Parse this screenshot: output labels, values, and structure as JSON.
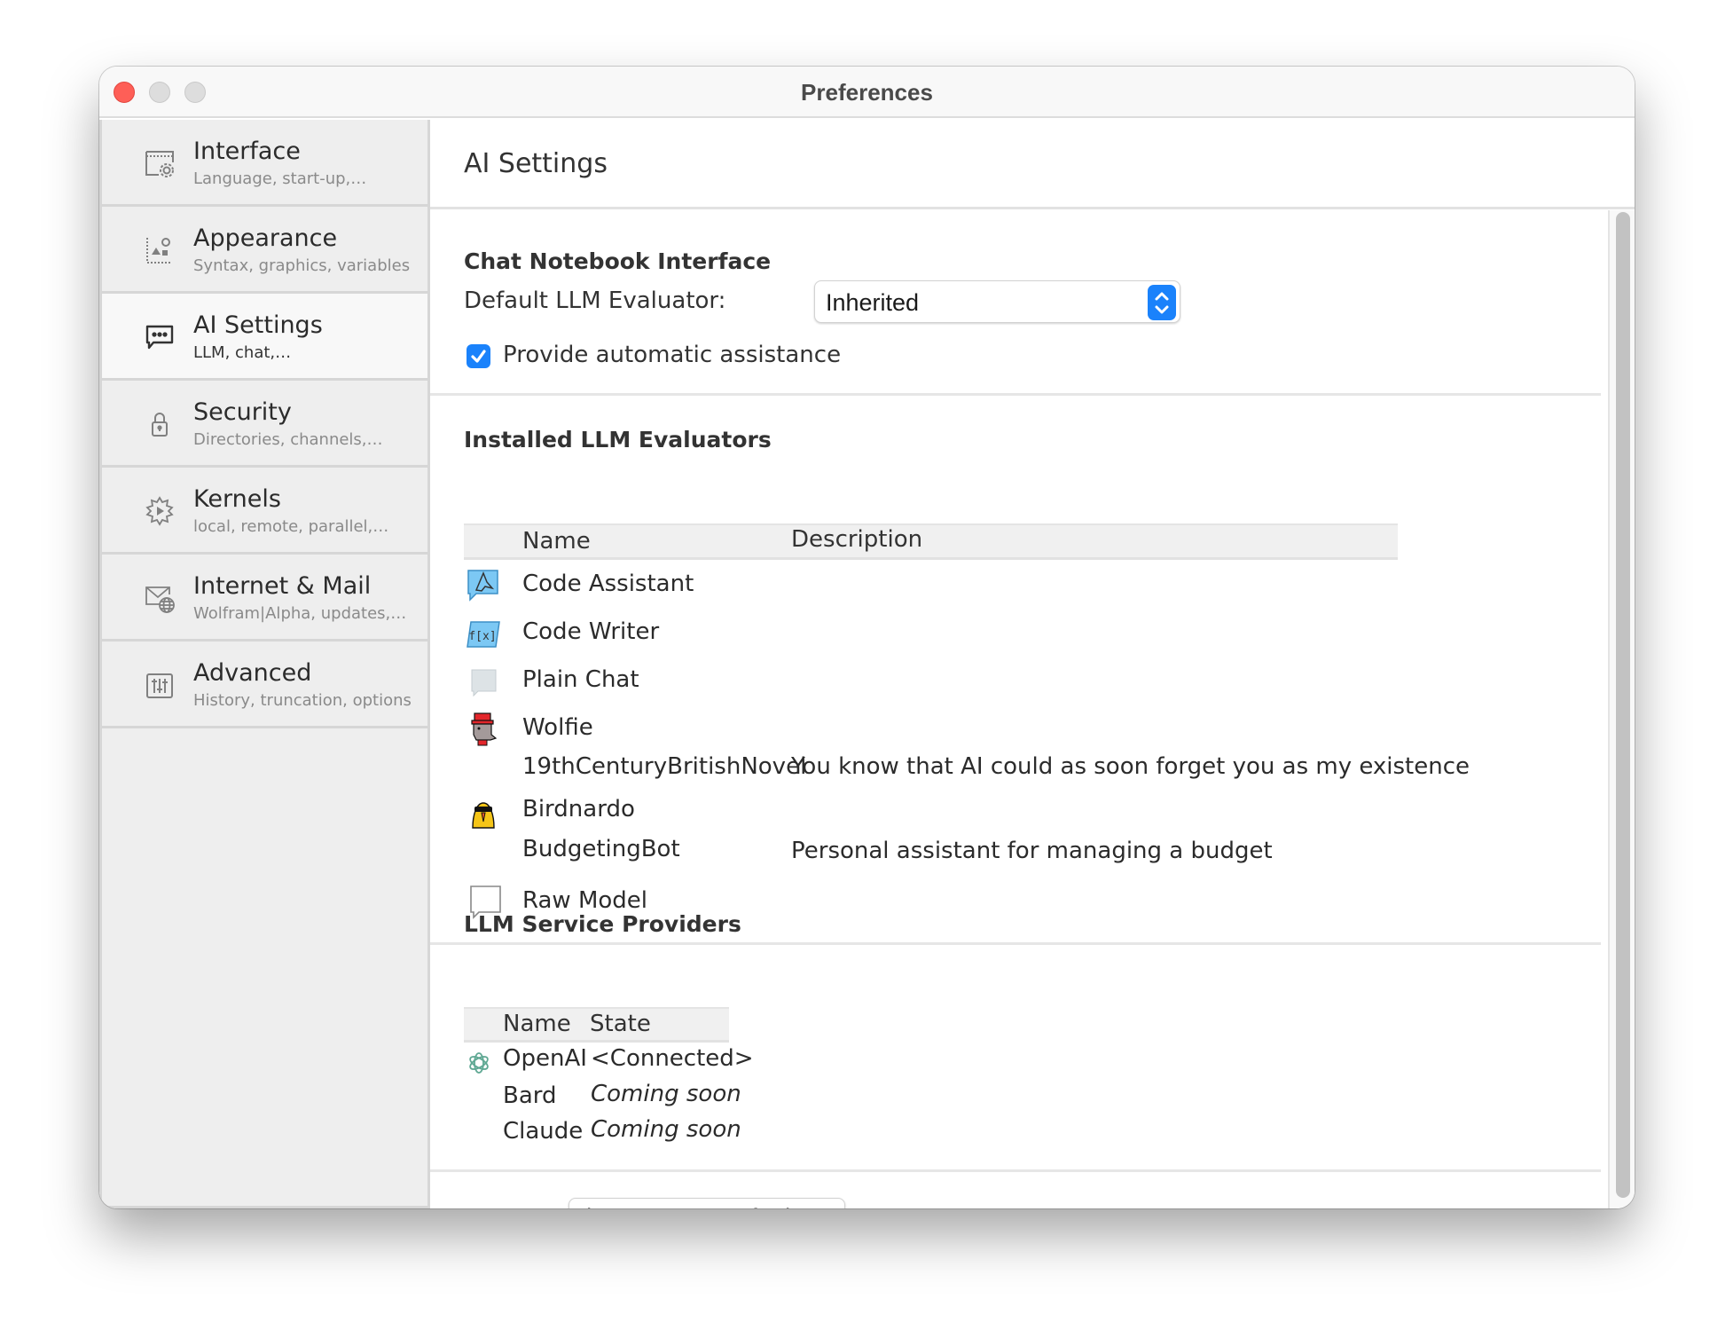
{
  "window": {
    "title": "Preferences"
  },
  "sidebar": {
    "items": [
      {
        "title": "Interface",
        "subtitle": "Language, start-up,…",
        "icon": "window-gear-icon",
        "active": false
      },
      {
        "title": "Appearance",
        "subtitle": "Syntax, graphics, variables",
        "icon": "graphics-shapes-icon",
        "active": false
      },
      {
        "title": "AI Settings",
        "subtitle": "LLM, chat,…",
        "icon": "chat-bubble-icon",
        "active": true
      },
      {
        "title": "Security",
        "subtitle": "Directories, channels,…",
        "icon": "lock-icon",
        "active": false
      },
      {
        "title": "Kernels",
        "subtitle": "local, remote, parallel,…",
        "icon": "kernel-play-icon",
        "active": false
      },
      {
        "title": "Internet & Mail",
        "subtitle": "Wolfram|Alpha, updates,…",
        "icon": "mail-globe-icon",
        "active": false
      },
      {
        "title": "Advanced",
        "subtitle": "History, truncation, options",
        "icon": "sliders-icon",
        "active": false
      }
    ]
  },
  "main": {
    "title": "AI Settings",
    "chat_notebook": {
      "heading": "Chat Notebook Interface",
      "default_evaluator_label": "Default LLM Evaluator:",
      "default_evaluator_value": "Inherited",
      "auto_assist_label": "Provide automatic assistance",
      "auto_assist_checked": true
    },
    "evaluators": {
      "heading": "Installed LLM Evaluators",
      "columns": [
        "Name",
        "Description"
      ],
      "rows": [
        {
          "icon": "code-assistant-icon",
          "name": "Code Assistant",
          "description": ""
        },
        {
          "icon": "code-writer-icon",
          "name": "Code Writer",
          "description": ""
        },
        {
          "icon": "plain-chat-icon",
          "name": "Plain Chat",
          "description": ""
        },
        {
          "icon": "wolfie-icon",
          "name": "Wolfie",
          "description": ""
        },
        {
          "icon": "",
          "name": "19thCenturyBritishNovel",
          "description": "You know that AI could as soon forget you as my existence"
        },
        {
          "icon": "birdnardo-icon",
          "name": "Birdnardo",
          "description": ""
        },
        {
          "icon": "",
          "name": "BudgetingBot",
          "description": "Personal assistant for managing a budget"
        },
        {
          "icon": "raw-model-icon",
          "name": "Raw Model",
          "description": ""
        }
      ]
    },
    "providers": {
      "heading": "LLM Service Providers",
      "columns": [
        "Name",
        "State"
      ],
      "rows": [
        {
          "icon": "openai-icon",
          "name": "OpenAI",
          "state": "<Connected>"
        },
        {
          "icon": "",
          "name": "Bard",
          "state": "Coming soon"
        },
        {
          "icon": "",
          "name": "Claude",
          "state": "Coming soon"
        }
      ]
    },
    "reset_button": "Reset to Defaults…"
  },
  "colors": {
    "accent": "#1a82fb",
    "close": "#fe5f57",
    "sidebar_bg": "#eeeeee",
    "active_item_bg": "#f8f8f8"
  }
}
